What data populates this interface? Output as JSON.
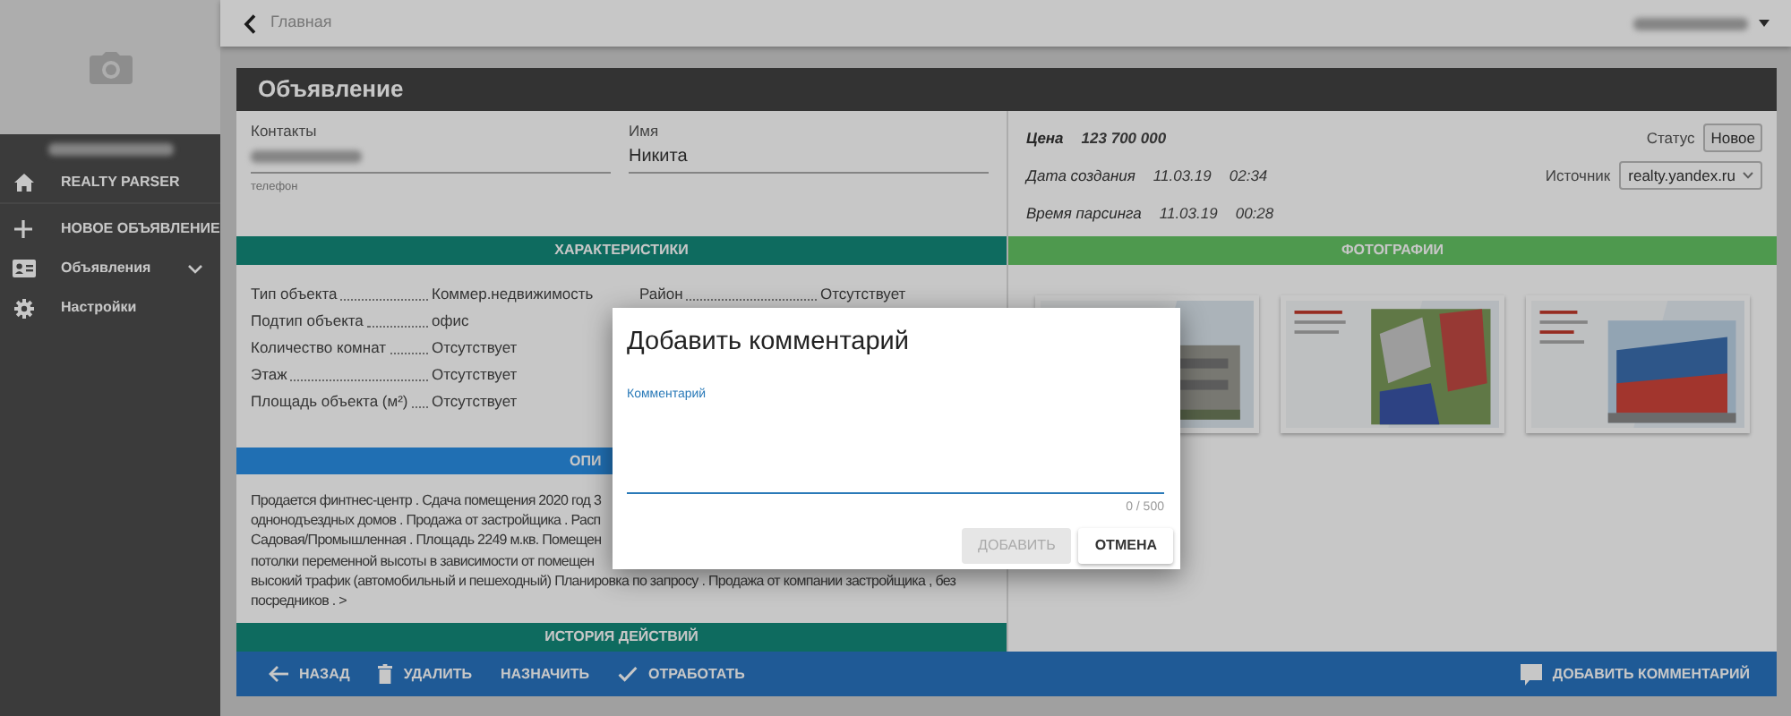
{
  "sidebar": {
    "items": [
      {
        "kind": "home",
        "label": "REALTY PARSER"
      },
      {
        "kind": "add",
        "label": "НОВОЕ ОБЪЯВЛЕНИЕ"
      },
      {
        "kind": "listings",
        "label": "Объявления",
        "expanded": false
      },
      {
        "kind": "settings",
        "label": "Настройки"
      }
    ]
  },
  "topbar": {
    "back_label": "Главная"
  },
  "ad": {
    "title": "Объявление",
    "contacts": {
      "label": "Контакты",
      "hint": "телефон"
    },
    "name": {
      "label": "Имя",
      "value": "Никита"
    },
    "price": {
      "label": "Цена",
      "value": "123 700 000"
    },
    "created": {
      "label": "Дата создания",
      "date": "11.03.19",
      "time": "02:34"
    },
    "parsed": {
      "label": "Время парсинга",
      "date": "11.03.19",
      "time": "00:28"
    },
    "status": {
      "label": "Статус",
      "value": "Новое"
    },
    "source": {
      "label": "Источник",
      "value": "realty.yandex.ru"
    }
  },
  "characteristics": {
    "title": "ХАРАКТЕРИСТИКИ",
    "left": [
      {
        "label": "Тип объекта",
        "value": "Коммер.недвижимость"
      },
      {
        "label": "Подтип объекта",
        "value": "офис"
      },
      {
        "label": "Количество комнат",
        "value": "Отсутствует"
      },
      {
        "label": "Этаж",
        "value": "Отсутствует"
      },
      {
        "label": "Площадь объекта (м²)",
        "value": "Отсутствует"
      }
    ],
    "right": [
      {
        "label": "Район",
        "value": "Отсутствует"
      }
    ]
  },
  "description": {
    "title": "ОПИ",
    "lines": [
      "Продается финтнес-центр . Сдача помещения 2020 год 3",
      "однонодъездных домов . Продажа от застройщика . Расп",
      "Садовая/Промышленная . Площадь 2249 м.кв. Помещен",
      "потолки переменной высоты в зависимости от помещен",
      "высокий трафик (автомобильный и пешеходный) Планировка по запросу . Продажа от компании застройщика , без",
      "посредников . >"
    ]
  },
  "photos": {
    "title": "ФОТОГРАФИИ"
  },
  "history": {
    "title": "ИСТОРИЯ ДЕЙСТВИЙ"
  },
  "actions": [
    {
      "kind": "back",
      "label": "НАЗАД"
    },
    {
      "kind": "delete",
      "label": "УДАЛИТЬ"
    },
    {
      "kind": "assign",
      "label": "НАЗНАЧИТЬ"
    },
    {
      "kind": "done",
      "label": "ОТРАБОТАТЬ"
    }
  ],
  "comment_action": {
    "kind": "comment",
    "label": "ДОБАВИТЬ КОММЕНТАРИЙ"
  },
  "dialog": {
    "title": "Добавить комментарий",
    "field_label": "Комментарий",
    "counter": "0 / 500",
    "buttons": [
      {
        "label": "ДОБАВИТЬ",
        "disabled": true
      },
      {
        "label": "ОТМЕНА",
        "disabled": false
      }
    ]
  }
}
